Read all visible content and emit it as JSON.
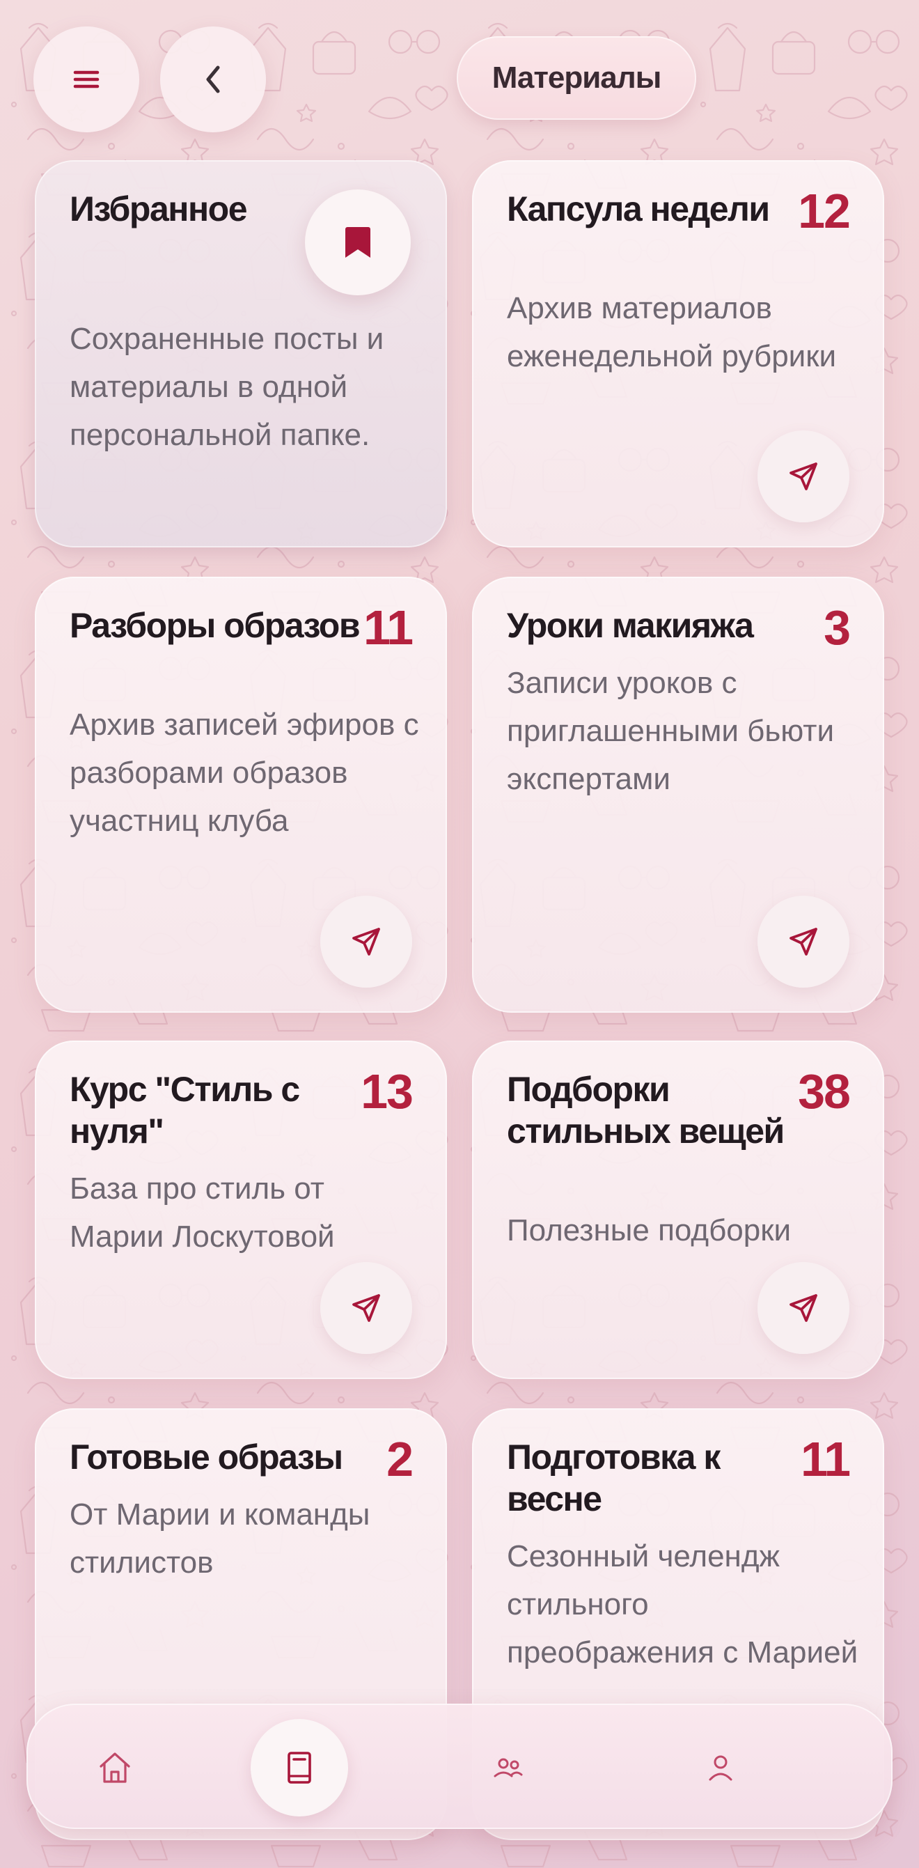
{
  "header": {
    "title": "Материалы",
    "menu_icon": "hamburger-menu-icon",
    "back_icon": "chevron-left-icon"
  },
  "favorites": {
    "title": "Избранное",
    "description": "Сохраненные посты и материалы в одной персональной папке.",
    "icon": "bookmark-icon"
  },
  "sections": [
    {
      "title": "Капсула недели",
      "count": "12",
      "description": "Архив материалов еженедельной рубрики"
    },
    {
      "title": "Разборы образов",
      "count": "11",
      "description": "Архив записей эфиров с разборами образов участниц клуба"
    },
    {
      "title": "Уроки макияжа",
      "count": "3",
      "description": "Записи уроков с приглашенными бьюти экспертами"
    },
    {
      "title": "Курс \"Стиль с нуля\"",
      "count": "13",
      "description": "База про стиль от Марии Лоскутовой"
    },
    {
      "title": "Подборки стильных вещей",
      "count": "38",
      "description": "Полезные подборки"
    },
    {
      "title": "Готовые образы",
      "count": "2",
      "description": "От Марии и команды стилистов"
    },
    {
      "title": "Подготовка к весне",
      "count": "11",
      "description": "Сезонный челендж стильного преображения с Марией"
    }
  ],
  "nav": [
    {
      "icon": "home-icon",
      "active": false
    },
    {
      "icon": "book-icon",
      "active": true
    },
    {
      "icon": "community-icon",
      "active": false
    },
    {
      "icon": "profile-icon",
      "active": false
    }
  ],
  "colors": {
    "accent": "#b3213e",
    "title_text": "#221a20",
    "description_text": "#6e6771",
    "nav_icon": "#c04868"
  }
}
